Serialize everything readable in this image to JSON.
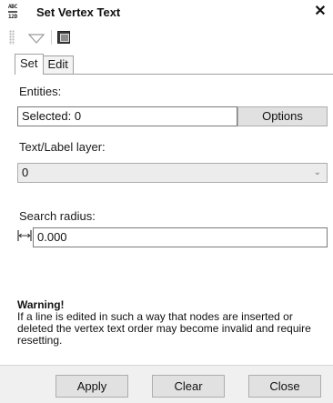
{
  "window": {
    "title": "Set Vertex Text",
    "app_icon_text": "ABC 12D",
    "close_label": "✕"
  },
  "toolbar": {
    "icons": [
      "grip-icon",
      "dropdown-triangle-icon",
      "screen-icon"
    ]
  },
  "tabs": [
    {
      "label": "Set",
      "active": true
    },
    {
      "label": "Edit",
      "active": false
    }
  ],
  "form": {
    "entities_label": "Entities:",
    "selected_value": "Selected: 0",
    "options_button": "Options",
    "layer_label": "Text/Label layer:",
    "layer_value": "0",
    "search_radius_label": "Search radius:",
    "search_radius_value": "0.000"
  },
  "warning": {
    "title": "Warning!",
    "text": "If a line is edited in such a way that nodes are inserted or deleted the vertex text order may become invalid and require resetting."
  },
  "buttons": {
    "apply": "Apply",
    "clear": "Clear",
    "close": "Close"
  }
}
